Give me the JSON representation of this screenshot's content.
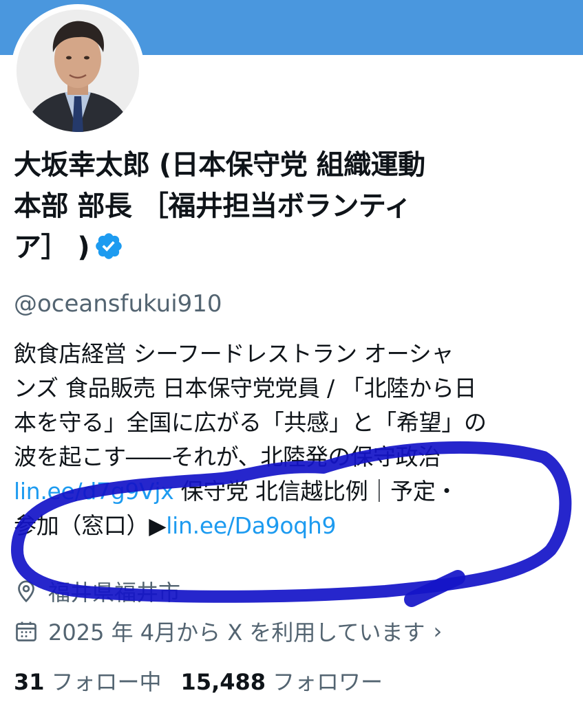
{
  "profile": {
    "display_name_lines": [
      "大坂幸太郎 (日本保守党 組織運動",
      "本部 部長 ［福井担当ボランティ",
      "ア］ )"
    ],
    "handle": "@oceansfukui910",
    "verified_icon": "verified-badge-icon",
    "bio": {
      "line1": "飲食店経営 シーフードレストラン オーシャ",
      "line2": "ンズ 食品販売 日本保守党党員 / 「北陸から日",
      "line3": "本を守る」全国に広がる「共感」と「希望」の",
      "line4": "波を起こす――それが、北陸発の保守政治",
      "link1": "lin.ee/d7g9Vjx",
      "line5_rest": " 保守党 北信越比例｜予定・",
      "line6_prefix": "参加（窓口）▶",
      "link2": "lin.ee/Da9oqh9"
    },
    "location": "福井県福井市",
    "joined": "2025 年 4月から X を利用しています",
    "following_count": "31",
    "following_label": "フォロー中",
    "followers_count": "15,488",
    "followers_label": "フォロワー"
  },
  "colors": {
    "banner": "#4a97de",
    "link": "#1d9bf0",
    "muted": "#536471",
    "verified": "#1d9bf0",
    "scribble": "#1414c8"
  }
}
